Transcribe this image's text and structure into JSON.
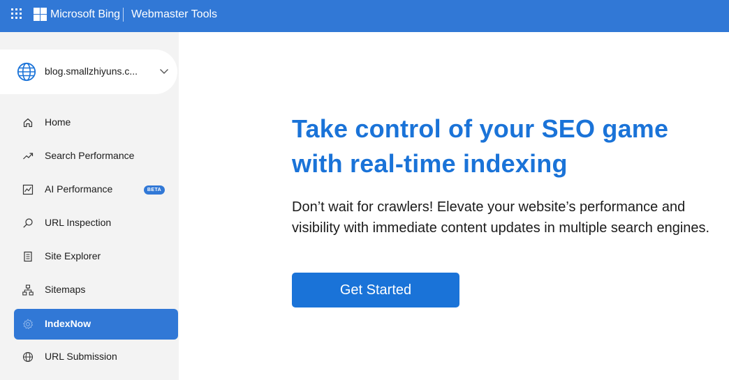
{
  "topbar": {
    "brand": "Microsoft Bing",
    "product": "Webmaster Tools",
    "color": "#3178d6"
  },
  "sidebar": {
    "site": "blog.smallzhiyuns.c...",
    "items": [
      {
        "label": "Home",
        "icon": "home-icon"
      },
      {
        "label": "Search Performance",
        "icon": "trend-icon"
      },
      {
        "label": "AI Performance",
        "icon": "ai-chart-icon",
        "badge": "BETA"
      },
      {
        "label": "URL Inspection",
        "icon": "search-icon"
      },
      {
        "label": "Site Explorer",
        "icon": "document-icon"
      },
      {
        "label": "Sitemaps",
        "icon": "sitemap-icon"
      },
      {
        "label": "IndexNow",
        "icon": "gear-icon",
        "active": true
      },
      {
        "label": "URL Submission",
        "icon": "globe-icon"
      }
    ]
  },
  "main": {
    "headline_line1": "Take control of your SEO game",
    "headline_line2": "with real-time indexing",
    "description": "Don’t wait for crawlers! Elevate your website’s performance and visibility with immediate content updates in multiple search engines.",
    "cta_label": "Get Started",
    "accent": "#1a73d8"
  }
}
